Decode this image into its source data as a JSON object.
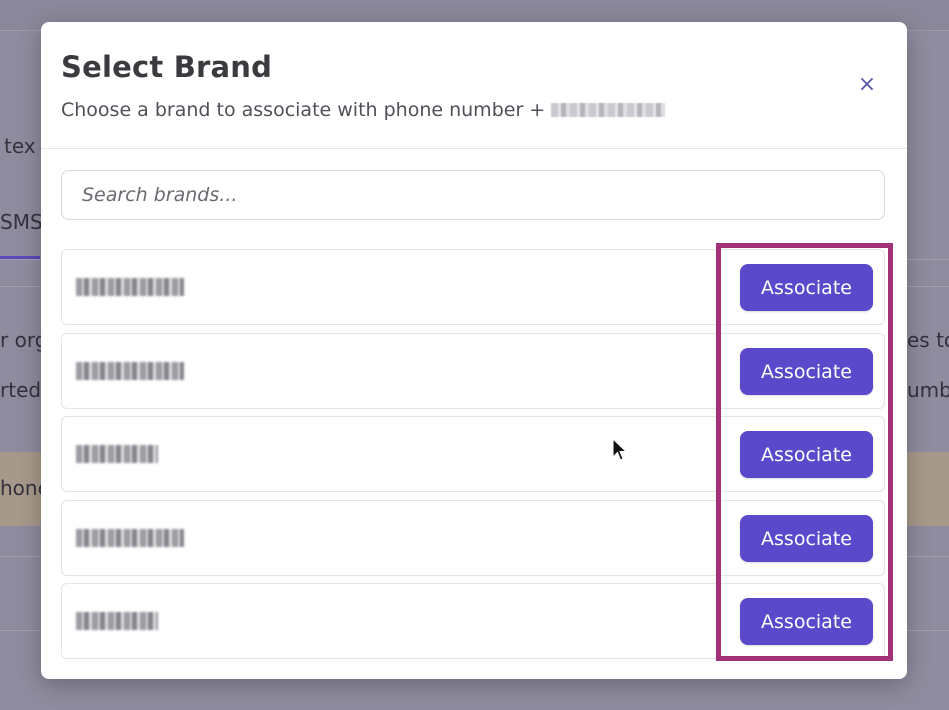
{
  "background": {
    "fragments": [
      "tex",
      "SMS",
      "r org",
      "rted,",
      "hone",
      "es to",
      "umbe"
    ],
    "accent_color": "#5b49b8"
  },
  "modal": {
    "title": "Select Brand",
    "subtitle": "Choose a brand to associate with phone number +",
    "close_icon": "×",
    "search": {
      "placeholder": "Search brands...",
      "value": ""
    },
    "brands": [
      {
        "name": "[redacted]",
        "action_label": "Associate"
      },
      {
        "name": "[redacted]",
        "action_label": "Associate"
      },
      {
        "name": "[redacted]",
        "action_label": "Associate"
      },
      {
        "name": "[redacted]",
        "action_label": "Associate"
      },
      {
        "name": "[redacted]",
        "action_label": "Associate"
      }
    ],
    "button_color": "#5b49cc"
  },
  "annotation": {
    "highlight_color": "#a1327a"
  }
}
